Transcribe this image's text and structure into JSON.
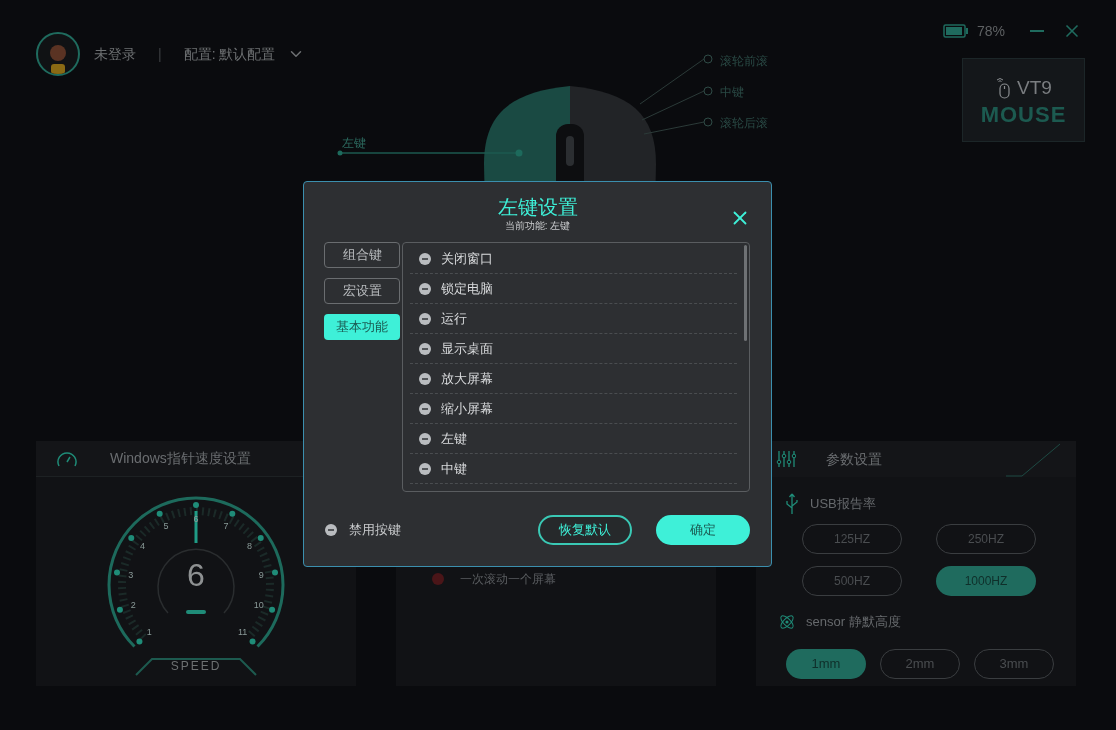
{
  "header": {
    "user": "未登录",
    "separator": "|",
    "profile": "配置: 默认配置",
    "battery": "78%"
  },
  "device": {
    "model": "VT9",
    "brand": "MOUSE"
  },
  "mouse_labels": [
    "左键",
    "滚轮前滚",
    "中键",
    "滚轮后滚"
  ],
  "pointer_panel": {
    "title": "Windows指针速度设置",
    "value": "6",
    "caption": "SPEED",
    "dial_labels": [
      "1",
      "2",
      "3",
      "4",
      "5",
      "6",
      "7",
      "8",
      "9",
      "10",
      "11"
    ]
  },
  "scroll_panel": {
    "options": [
      {
        "label": "一次滚动一个屏幕",
        "selected": false
      }
    ]
  },
  "params_panel": {
    "title": "参数设置",
    "usb": {
      "label": "USB报告率",
      "options": [
        {
          "label": "125HZ",
          "selected": false
        },
        {
          "label": "250HZ",
          "selected": false
        },
        {
          "label": "500HZ",
          "selected": false
        },
        {
          "label": "1000HZ",
          "selected": true
        }
      ]
    },
    "sensor": {
      "label": "sensor 静默高度",
      "options": [
        {
          "label": "1mm",
          "selected": true
        },
        {
          "label": "2mm",
          "selected": false
        },
        {
          "label": "3mm",
          "selected": false
        }
      ]
    }
  },
  "dialog": {
    "title": "左键设置",
    "subtitle": "当前功能: 左键",
    "tabs": [
      {
        "label": "组合键",
        "selected": false
      },
      {
        "label": "宏设置",
        "selected": false
      },
      {
        "label": "基本功能",
        "selected": true
      }
    ],
    "functions": [
      "关闭窗口",
      "锁定电脑",
      "运行",
      "显示桌面",
      "放大屏幕",
      "缩小屏幕",
      "左键",
      "中键"
    ],
    "disable": {
      "label": "禁用按键"
    },
    "buttons": [
      {
        "label": "恢复默认",
        "kind": "outline"
      },
      {
        "label": "确定",
        "kind": "primary"
      }
    ]
  }
}
